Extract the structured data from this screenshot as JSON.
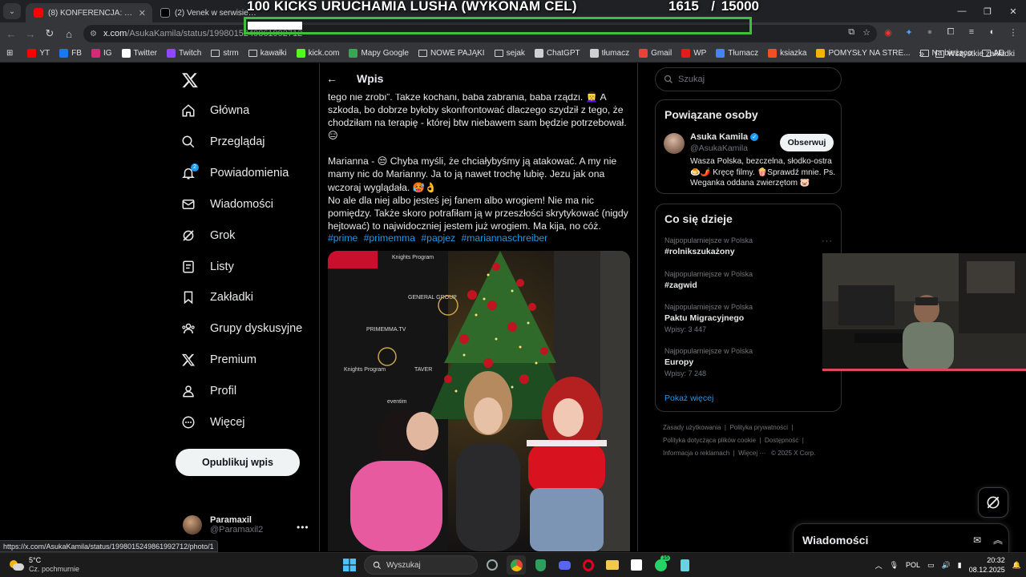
{
  "browser": {
    "tabs": [
      {
        "title": "(8) KONFERENCJA: Natan, Dzig",
        "active": true,
        "favicon_color": "#ff0000"
      },
      {
        "title": "(2) Venek w serwisie X: „a to",
        "active": false,
        "favicon_color": "#ffffff"
      }
    ],
    "address": {
      "host": "x.com",
      "path": "/AsukaKamila/status/1998015249861992712"
    },
    "bookmarks": [
      {
        "label": "YT",
        "icon": "youtube-icon",
        "color": "#ff0000"
      },
      {
        "label": "FB",
        "icon": "facebook-icon",
        "color": "#1877f2"
      },
      {
        "label": "IG",
        "icon": "instagram-icon",
        "color": "#d62976"
      },
      {
        "label": "Twitter",
        "icon": "x-icon",
        "color": "#ffffff"
      },
      {
        "label": "Twitch",
        "icon": "twitch-icon",
        "color": "#9146ff"
      },
      {
        "label": "strm",
        "icon": "folder-icon",
        "color": ""
      },
      {
        "label": "kawałki",
        "icon": "folder-icon",
        "color": ""
      },
      {
        "label": "kick.com",
        "icon": "kick-icon",
        "color": "#53fc18"
      },
      {
        "label": "Mapy Google",
        "icon": "maps-icon",
        "color": "#34a853"
      },
      {
        "label": "NOWE PAJĄKI",
        "icon": "folder-icon",
        "color": ""
      },
      {
        "label": "sejak",
        "icon": "folder-icon",
        "color": ""
      },
      {
        "label": "ChatGPT",
        "icon": "chatgpt-icon",
        "color": "#d0d0d0"
      },
      {
        "label": "tłumacz",
        "icon": "chatgpt-icon",
        "color": "#d0d0d0"
      },
      {
        "label": "Gmail",
        "icon": "gmail-icon",
        "color": "#ea4335"
      },
      {
        "label": "WP",
        "icon": "wp-icon",
        "color": "#e21b1b"
      },
      {
        "label": "Tłumacz",
        "icon": "translate-icon",
        "color": "#4285f4"
      },
      {
        "label": "ksiazka",
        "icon": "microsoft-icon",
        "color": "#f25022"
      },
      {
        "label": "POMYSŁY NA STRE...",
        "icon": "sticky-icon",
        "color": "#f4b400"
      },
      {
        "label": "Na bieżąco",
        "icon": "folder-icon",
        "color": ""
      },
      {
        "label": "AD",
        "icon": "folder-icon",
        "color": ""
      }
    ],
    "all_bookmarks": "Wszystkie zakładki",
    "status_url": "https://x.com/AsukaKamila/status/1998015249861992712/photo/1"
  },
  "overlay": {
    "title": "100 KICKS URUCHAMIA LUSHA (WYKONAM CEL)",
    "count": "1615",
    "goal": "/ 15000",
    "progress_fraction": 0.108,
    "accent": "#3fbf3f"
  },
  "nav": {
    "items": [
      {
        "label": "Główna",
        "icon": "home-icon"
      },
      {
        "label": "Przeglądaj",
        "icon": "search-icon"
      },
      {
        "label": "Powiadomienia",
        "icon": "bell-icon",
        "badge": "2"
      },
      {
        "label": "Wiadomości",
        "icon": "mail-icon"
      },
      {
        "label": "Grok",
        "icon": "grok-icon"
      },
      {
        "label": "Listy",
        "icon": "list-icon"
      },
      {
        "label": "Zakładki",
        "icon": "bookmark-icon"
      },
      {
        "label": "Grupy dyskusyjne",
        "icon": "communities-icon"
      },
      {
        "label": "Premium",
        "icon": "x-icon"
      },
      {
        "label": "Profil",
        "icon": "profile-icon"
      },
      {
        "label": "Więcej",
        "icon": "more-circle-icon"
      }
    ],
    "post_button": "Opublikuj wpis",
    "profile": {
      "name": "Paramaxil",
      "handle": "@Paramaxil2"
    }
  },
  "main": {
    "header_title": "Wpis",
    "text_paragraphs": [
      "tego nie zrobi”. Także kochani, baba zabrania, baba rządzi. 👱‍♀️ A szkoda, bo dobrze byłoby skonfrontować dlaczego szydził z tego, że chodziłam na terapię - której btw niebawem sam będzie potrzebował. 😑",
      "Marianna - 😒 Chyba myśli, że chciałybyśmy ją atakować. A my nie mamy nic do Marianny. Ja to ją nawet trochę lubię. Jezu jak ona wczoraj wyglądała. 🥵👌",
      "No ale dla niej albo jesteś jej fanem albo wrogiem! Nie ma nic pomiędzy. Także skoro potrafiłam ją w przeszłości skrytykować (nigdy hejtować) to najwidoczniej jestem już wrogiem. Ma kija, no cóż."
    ],
    "hashtags": [
      "#prime",
      "#primemma",
      "#papjez",
      "#mariannaschreiber"
    ]
  },
  "right": {
    "search_placeholder": "Szukaj",
    "related_title": "Powiązane osoby",
    "person": {
      "name": "Asuka Kamila",
      "handle": "@AsukaKamila",
      "follow": "Obserwuj",
      "bio": "Wasza Polska, bezczelna, słodko-ostra 🍮🌶️ Kręcę filmy. 🍿Sprawdź mnie. Ps. Weganka oddana zwierzętom 🐷"
    },
    "trends_title": "Co się dzieje",
    "trends": [
      {
        "meta": "Najpopularniejsze w Polska",
        "name": "#rolnikszukażony",
        "count": ""
      },
      {
        "meta": "Najpopularniejsze w Polska",
        "name": "#zagwid",
        "count": ""
      },
      {
        "meta": "Najpopularniejsze w Polska",
        "name": "Paktu Migracyjnego",
        "count": "Wpisy: 3 447"
      },
      {
        "meta": "Najpopularniejsze w Polska",
        "name": "Europy",
        "count": "Wpisy: 7 248"
      }
    ],
    "show_more": "Pokaż więcej",
    "footer": {
      "terms": "Zasady użytkowania",
      "privacy": "Polityka prywatności",
      "cookies": "Polityka dotycząca plików cookie",
      "accessibility": "Dostępność",
      "ads": "Informacja o reklamach",
      "more": "Więcej ···",
      "copyright": "© 2025 X Corp."
    },
    "messages_drawer": "Wiadomości"
  },
  "taskbar": {
    "temp": "5°C",
    "weather": "Cz. pochmurnie",
    "search": "Wyszukaj",
    "lang": "POL",
    "time": "20:32",
    "date": "08.12.2025",
    "whatsapp_badge": "15"
  }
}
